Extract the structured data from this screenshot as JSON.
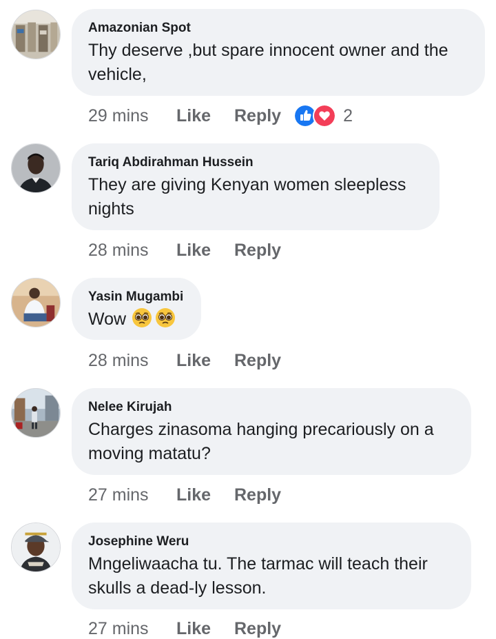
{
  "comments": [
    {
      "author": "Amazonian Spot",
      "text": "Thy deserve ,but spare innocent owner and the\nvehicle,",
      "time": "29 mins",
      "like_label": "Like",
      "reply_label": "Reply",
      "reactions": {
        "types": [
          "like-icon",
          "love-icon"
        ],
        "count": "2"
      },
      "avatar": "avatar-storefront"
    },
    {
      "author": "Tariq Abdirahman Hussein",
      "text": "They are giving Kenyan women sleepless\nnights",
      "time": "28 mins",
      "like_label": "Like",
      "reply_label": "Reply",
      "avatar": "avatar-portrait-man"
    },
    {
      "author": "Yasin Mugambi",
      "text": "Wow",
      "emojis": [
        "pleading-face-icon",
        "pleading-face-icon"
      ],
      "time": "28 mins",
      "like_label": "Like",
      "reply_label": "Reply",
      "avatar": "avatar-seated-man"
    },
    {
      "author": "Nelee Kirujah",
      "text": "Charges zinasoma hanging precariously on a\nmoving matatu?",
      "time": "27 mins",
      "like_label": "Like",
      "reply_label": "Reply",
      "avatar": "avatar-street-scene"
    },
    {
      "author": "Josephine Weru",
      "text": "Mngeliwaacha tu. The tarmac will teach their\nskulls a dead-ly lesson.",
      "time": "27 mins",
      "like_label": "Like",
      "reply_label": "Reply",
      "avatar": "avatar-woman-cap"
    }
  ],
  "colors": {
    "bubble": "#f0f2f5",
    "text": "#1c1e21",
    "meta": "#65676b",
    "like_reaction": "#1877f2",
    "love_reaction": "#f33e58"
  }
}
